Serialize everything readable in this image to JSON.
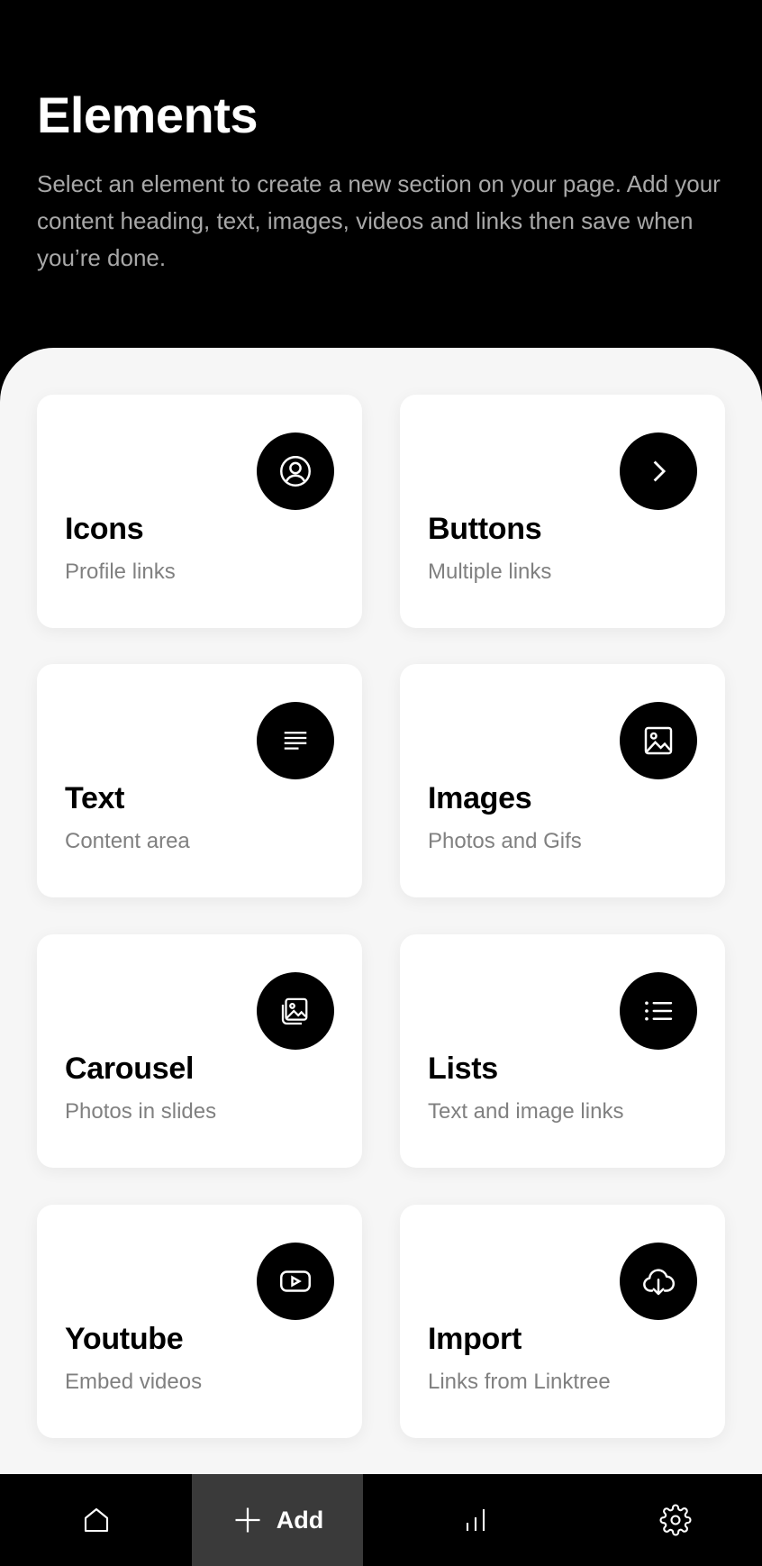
{
  "header": {
    "title": "Elements",
    "description": "Select an element to create a new section on your page. Add your content heading, text, images, videos and links then save when you’re done."
  },
  "elements": [
    {
      "title": "Icons",
      "subtitle": "Profile links",
      "icon": "user-circle-icon"
    },
    {
      "title": "Buttons",
      "subtitle": "Multiple links",
      "icon": "chevron-right-icon"
    },
    {
      "title": "Text",
      "subtitle": "Content area",
      "icon": "text-lines-icon"
    },
    {
      "title": "Images",
      "subtitle": "Photos and Gifs",
      "icon": "image-icon"
    },
    {
      "title": "Carousel",
      "subtitle": "Photos in slides",
      "icon": "gallery-icon"
    },
    {
      "title": "Lists",
      "subtitle": "Text and image links",
      "icon": "list-icon"
    },
    {
      "title": "Youtube",
      "subtitle": "Embed videos",
      "icon": "youtube-icon"
    },
    {
      "title": "Import",
      "subtitle": "Links from Linktree",
      "icon": "cloud-download-icon"
    }
  ],
  "nav": {
    "items": [
      {
        "icon": "home-icon"
      },
      {
        "label": "Add",
        "icon": "plus-icon",
        "active": true
      },
      {
        "icon": "analytics-icon"
      },
      {
        "icon": "settings-icon"
      }
    ]
  },
  "colors": {
    "background": "#000000",
    "sheet": "#f6f6f6",
    "card": "#ffffff",
    "muted_text": "#808080",
    "nav_active": "#3a3a3a"
  }
}
